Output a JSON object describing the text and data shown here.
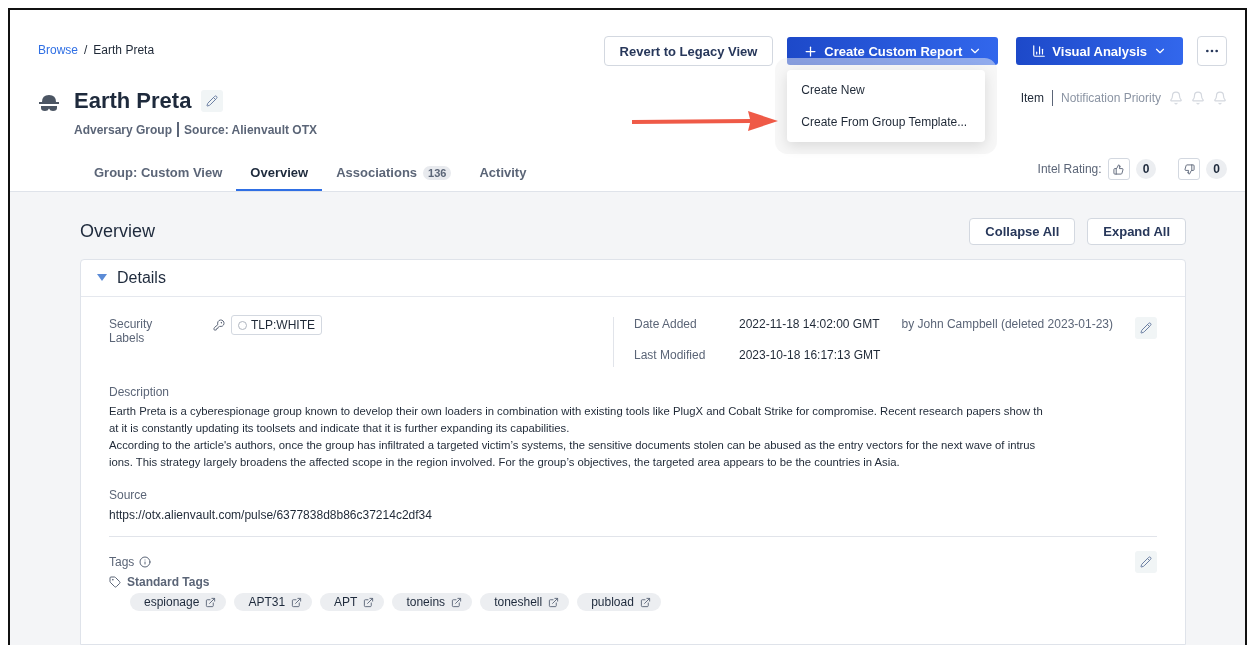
{
  "breadcrumb": {
    "items": [
      {
        "label": "Browse",
        "link": true
      },
      {
        "label": "Earth Preta",
        "link": false
      }
    ],
    "separator": "/"
  },
  "header_buttons": {
    "revert": "Revert to Legacy View",
    "create_report": "Create Custom Report",
    "visual_analysis": "Visual Analysis"
  },
  "dropdown": {
    "open": true,
    "items": [
      "Create New",
      "Create From Group Template..."
    ]
  },
  "title": "Earth Preta",
  "subtitle": [
    "Adversary Group",
    "Source: Alienvault OTX"
  ],
  "follow": {
    "item": "Item",
    "priority": "Notification Priority"
  },
  "tabs": [
    {
      "label": "Group: Custom View",
      "selected": false
    },
    {
      "label": "Overview",
      "selected": true
    },
    {
      "label": "Associations",
      "count": "136",
      "selected": false
    },
    {
      "label": "Activity",
      "selected": false
    }
  ],
  "intel_rating": {
    "label": "Intel Rating:",
    "up": "0",
    "down": "0"
  },
  "overview": {
    "title": "Overview",
    "buttons": [
      "Collapse All",
      "Expand All"
    ]
  },
  "details": {
    "title": "Details",
    "expanded": true,
    "security_labels": {
      "label": "Security Labels",
      "tag": "TLP:WHITE"
    },
    "dates": [
      {
        "label": "Date Added",
        "value": "2022-11-18 14:02:00 GMT",
        "note": "by John Campbell (deleted 2023-01-23)"
      },
      {
        "label": "Last Modified",
        "value": "2023-10-18 16:17:13 GMT"
      }
    ],
    "description": {
      "label": "Description",
      "lines": [
        "Earth Preta is a cyberespionage group known to develop their own loaders in combination with existing tools like PlugX and Cobalt Strike for compromise. Recent research papers show th",
        "at it is constantly updating its toolsets and indicate that it is further expanding its capabilities.",
        "According to the article's authors, once the group has infiltrated a targeted victim’s systems, the sensitive documents stolen can be abused as the entry vectors for the next wave of intrus",
        "ions. This strategy largely broadens the affected scope in the region involved. For the group’s objectives, the targeted area appears to be the countries in Asia."
      ]
    },
    "source": {
      "label": "Source",
      "value": "https://otx.alienvault.com/pulse/6377838d8b86c37214c2df34"
    },
    "tags": {
      "label": "Tags",
      "group": "Standard Tags",
      "items": [
        "espionage",
        "APT31",
        "APT",
        "toneins",
        "toneshell",
        "pubload"
      ]
    }
  }
}
